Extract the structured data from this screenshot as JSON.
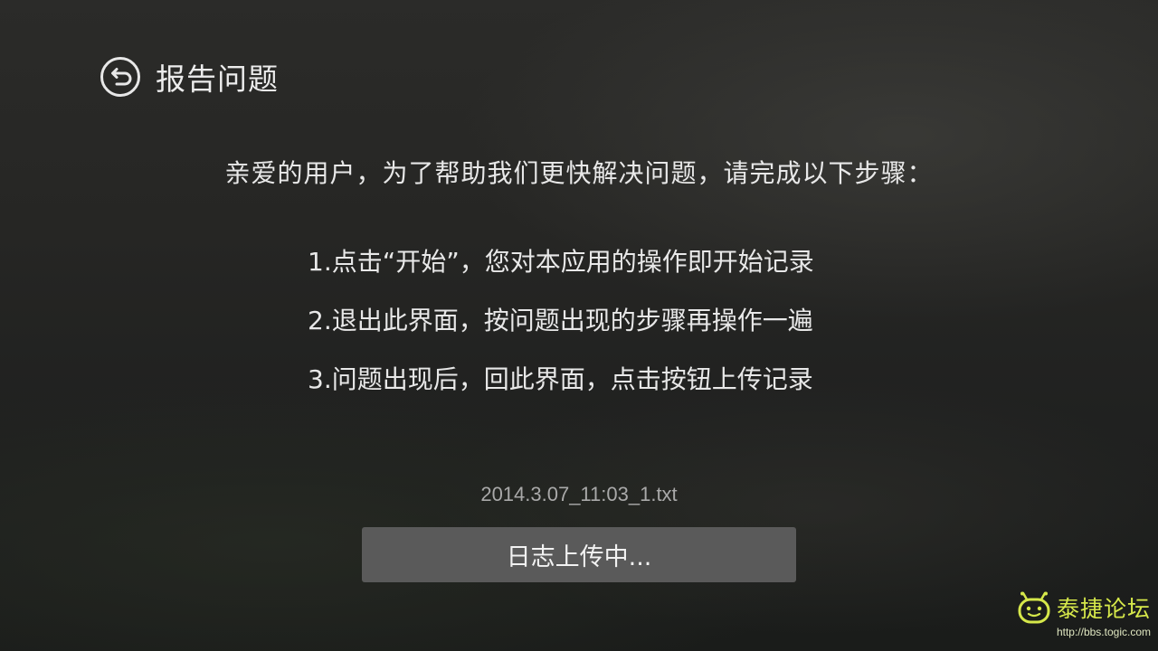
{
  "header": {
    "back_icon": "back-arrow-circle-icon",
    "title": "报告问题"
  },
  "intro": "亲爱的用户，为了帮助我们更快解决问题，请完成以下步骤：",
  "steps": [
    "1.点击“开始”，您对本应用的操作即开始记录",
    "2.退出此界面，按问题出现的步骤再操作一遍",
    "3.问题出现后，回此界面，点击按钮上传记录"
  ],
  "log_file": "2014.3.07_11:03_1.txt",
  "upload_button": {
    "label": "日志上传中..."
  },
  "watermark": {
    "logo_icon": "smiley-antenna-icon",
    "name": "泰捷论坛",
    "url": "http://bbs.togic.com"
  },
  "colors": {
    "button_bg": "#5a5a5a",
    "watermark_accent": "#d6e84a"
  }
}
